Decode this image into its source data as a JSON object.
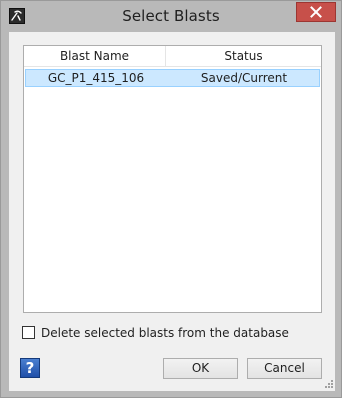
{
  "window": {
    "title": "Select Blasts",
    "icons": {
      "app": "pickaxe-app-icon",
      "close": "close-icon",
      "help": "help-question-icon",
      "grip": "resize-grip-icon"
    },
    "colors": {
      "close_button": "#c7504a",
      "selection_fill": "#cce8ff",
      "selection_border": "#99d1ff",
      "help_button": "#2a5cb8"
    }
  },
  "blast_list": {
    "columns": [
      "Blast Name",
      "Status"
    ],
    "rows": [
      {
        "name": "GC_P1_415_106",
        "status": "Saved/Current",
        "selected": true
      }
    ]
  },
  "options": {
    "delete_checkbox_label": "Delete selected blasts from the database",
    "delete_checked": false
  },
  "buttons": {
    "help": "?",
    "ok": "OK",
    "cancel": "Cancel"
  }
}
